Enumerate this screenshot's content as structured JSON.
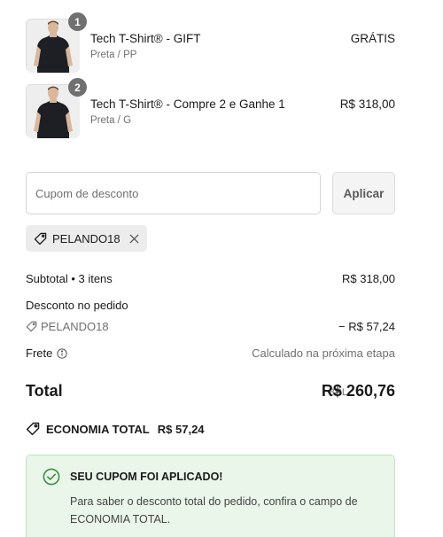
{
  "items": [
    {
      "quantity": "1",
      "name": "Tech T-Shirt® - GIFT",
      "variant": "Preta / PP",
      "price": "GRÁTIS"
    },
    {
      "quantity": "2",
      "name": "Tech T-Shirt® - Compre 2 e Ganhe 1",
      "variant": "Preta / G",
      "price": "R$ 318,00"
    }
  ],
  "coupon": {
    "placeholder": "Cupom de desconto",
    "apply_label": "Aplicar",
    "applied_code": "PELANDO18"
  },
  "summary": {
    "subtotal_label": "Subtotal • 3 itens",
    "subtotal_value": "R$ 318,00",
    "discount_label": "Desconto no pedido",
    "discount_code": "PELANDO18",
    "discount_value": "− R$ 57,24",
    "shipping_label": "Frete",
    "shipping_value": "Calculado na próxima etapa",
    "total_label": "Total",
    "total_currency": "BRL",
    "total_value": "R$ 260,76",
    "economy_label": "ECONOMIA TOTAL",
    "economy_value": "R$ 57,24"
  },
  "notice": {
    "title": "SEU CUPOM FOI APLICADO!",
    "text": "Para saber o desconto total do pedido, confira o campo de ECONOMIA TOTAL."
  },
  "icons": {
    "tag": "tag-icon",
    "close": "close-icon",
    "info": "info-icon",
    "check": "check-circle-icon",
    "product": "tshirt-product-image"
  },
  "colors": {
    "badge": "#707070",
    "notice_bg": "#eaf6ea",
    "notice_border": "#bfe3c2",
    "check": "#3a8f45"
  }
}
